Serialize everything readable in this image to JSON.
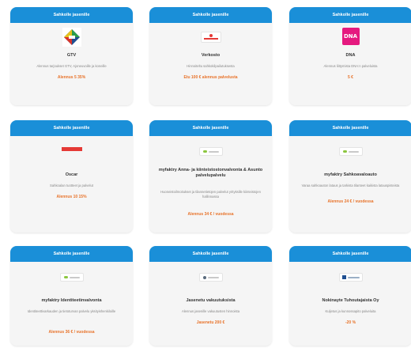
{
  "cards": [
    {
      "header": "Sahkolle jasenille",
      "logo": "gtv-diamond-logo",
      "title": "GTV",
      "desc": "Alennus tarjoukset GTV, Ajoneuvoille ja koneille",
      "offer": "Alennus 5 35%"
    },
    {
      "header": "Sahkolle jasenille",
      "logo": "verkosto-logo",
      "title": "Verkosto",
      "desc": "Hinnoiteltu sahkokilpailutuksesta",
      "offer": "Etu 100 € alennus palvelusta"
    },
    {
      "header": "Sahkolle jasenille",
      "logo": "dna-logo",
      "logo_text": "DNA",
      "title": "DNA",
      "desc": "Alennus liittymista DNA:n palveluista",
      "offer": "5 €"
    },
    {
      "header": "Sahkolle jasenille",
      "logo": "oscar-logo",
      "title": "Oscar",
      "desc": "Sahkoalan tuotteet ja palvelut",
      "offer": "Alennus 10 15%"
    },
    {
      "header": "Sahkolle jasenille",
      "logo": "myfaktry-logo",
      "title": "myfaktry Anna- ja kiinteistostonvalvonta & Asunto palvelupalvelu",
      "desc": "Huoneistoilmoitukset ja tilannetietojen palvelut yrityksille kiinteistojen hallinnassa",
      "offer": "Alennus 34 € / vuodessa"
    },
    {
      "header": "Sahkolle jasenille",
      "logo": "myfaktry-logo",
      "title": "myfaktry Sahkoavaloauto",
      "desc": "Varaa sahkoauton lataus ja tarkista tilanteet kaikista latauspisteista",
      "offer": "Alennus 24 € / vuodessa"
    },
    {
      "header": "Sahkolle jasenille",
      "logo": "myfaktry-logo",
      "title": "myfaktry Identiteetinvalvonta",
      "desc": "Identiteettivarkauden ja tietoturvan palvelu yksityishenkiloille",
      "offer": "Alennus 36 € / vuodessa"
    },
    {
      "header": "Sahkolle jasenille",
      "logo": "jasenetu-logo",
      "title": "Jasenetu vakuutuksista",
      "desc": "Alennus jasenille vakuutusten hinnoista",
      "offer": "Jasenetu 200 €"
    },
    {
      "header": "Sahkolle jasenille",
      "logo": "nokinaytto-logo",
      "title": "Nokinayte Tuhoutajaista Oy",
      "desc": "Kuljetus ja kunnossapito palveluita",
      "offer": "-20 %"
    }
  ]
}
